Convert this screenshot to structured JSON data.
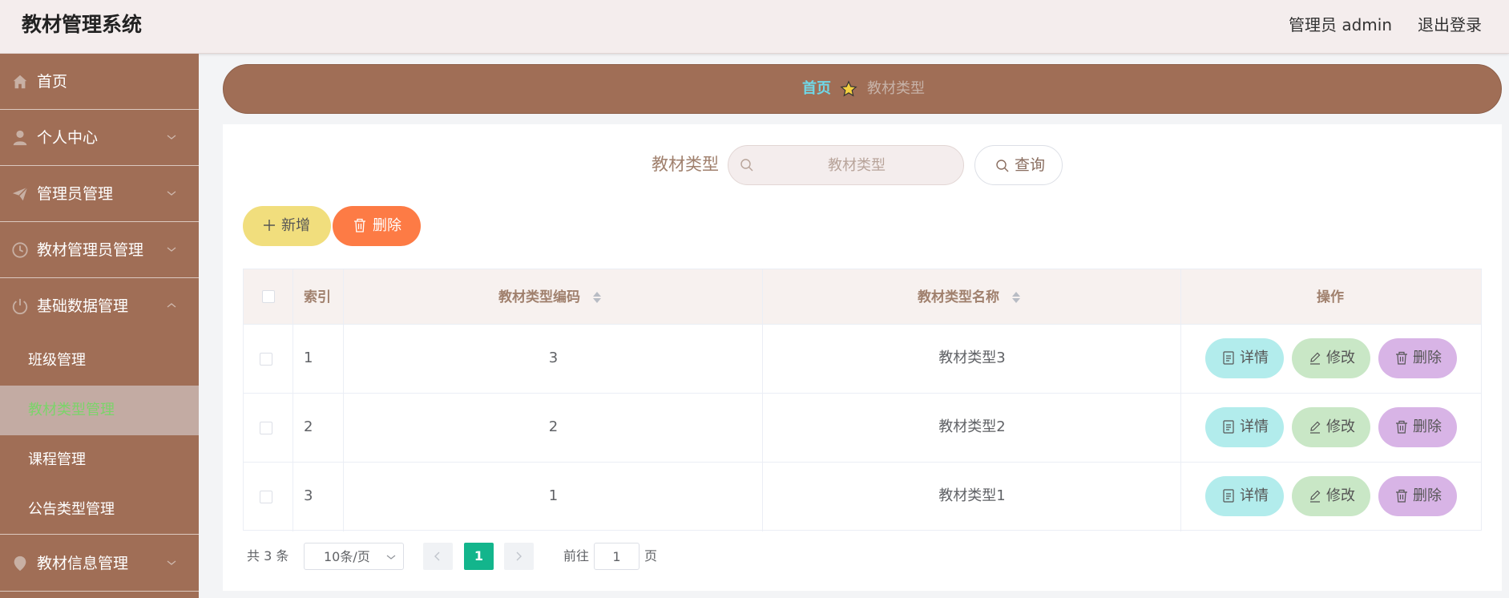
{
  "header": {
    "app_title": "教材管理系统",
    "user_label": "管理员 admin",
    "logout_label": "退出登录"
  },
  "sidebar": {
    "items": [
      {
        "label": "首页",
        "icon": "home-icon"
      },
      {
        "label": "个人中心",
        "icon": "user-icon"
      },
      {
        "label": "管理员管理",
        "icon": "paper-plane-icon"
      },
      {
        "label": "教材管理员管理",
        "icon": "clock-icon"
      },
      {
        "label": "基础数据管理",
        "icon": "power-icon",
        "expanded": true
      }
    ],
    "sub_items": [
      {
        "label": "班级管理"
      },
      {
        "label": "教材类型管理",
        "active": true
      },
      {
        "label": "课程管理"
      },
      {
        "label": "公告类型管理"
      }
    ],
    "tail_item": {
      "label": "教材信息管理",
      "icon": "location-icon"
    }
  },
  "breadcrumb": {
    "home": "首页",
    "current": "教材类型"
  },
  "search": {
    "label": "教材类型",
    "placeholder": "教材类型",
    "query_label": "查询"
  },
  "actions": {
    "add_label": "新增",
    "delete_label": "删除"
  },
  "table": {
    "headers": {
      "index": "索引",
      "code": "教材类型编码",
      "name": "教材类型名称",
      "operations": "操作"
    },
    "rows": [
      {
        "index": "1",
        "code": "3",
        "name": "教材类型3"
      },
      {
        "index": "2",
        "code": "2",
        "name": "教材类型2"
      },
      {
        "index": "3",
        "code": "1",
        "name": "教材类型1"
      }
    ],
    "op_labels": {
      "detail": "详情",
      "edit": "修改",
      "delete": "删除"
    }
  },
  "pagination": {
    "total": "共 3 条",
    "page_size": "10条/页",
    "current_page": "1",
    "goto_label": "前往",
    "goto_value": "1",
    "goto_suffix": "页"
  },
  "colors": {
    "sidebar_bg": "#a06e56",
    "active_text": "#7bd46a",
    "breadcrumb_home": "#6fd8e8",
    "add_button": "#f1de7d",
    "delete_button": "#fd7b45",
    "detail_button": "#b2ecec",
    "edit_button": "#c9e7c6",
    "row_delete_button": "#d8b4e6",
    "pager_active": "#13b58c"
  }
}
